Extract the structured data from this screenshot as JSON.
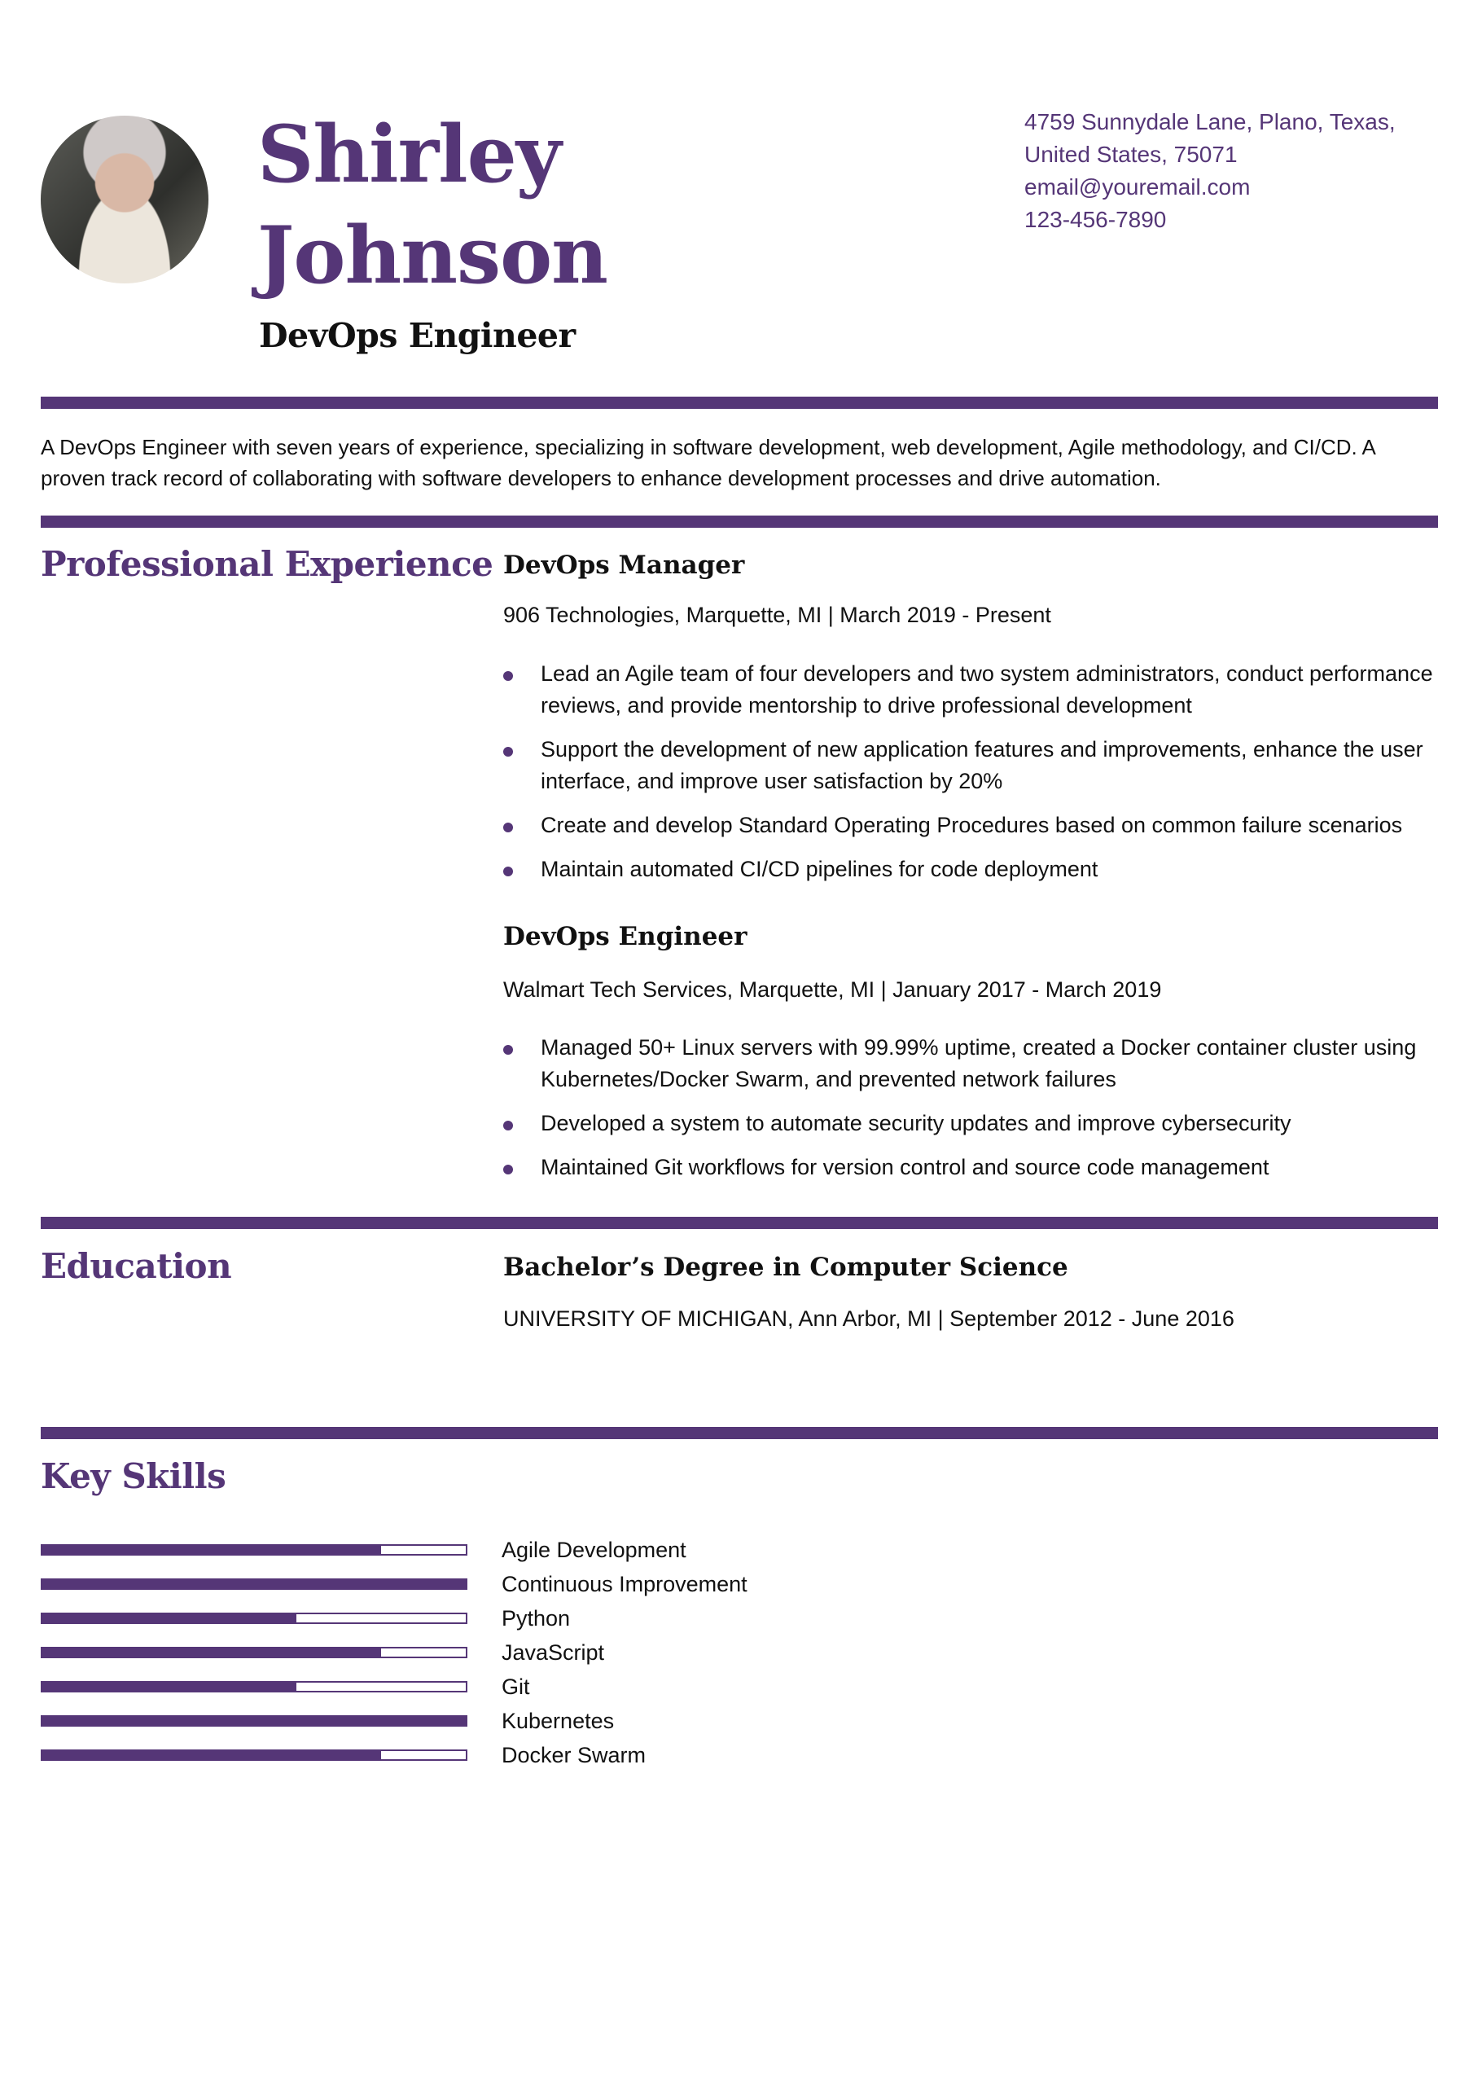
{
  "header": {
    "first_name": "Shirley",
    "last_name": "Johnson",
    "title": "DevOps Engineer",
    "photo_alt": "Profile photo"
  },
  "contact": {
    "address_line1": "4759 Sunnydale Lane, Plano, Texas,",
    "address_line2": "United States, 75071",
    "email": "email@youremail.com",
    "phone": "123-456-7890"
  },
  "summary": "A DevOps Engineer with seven years of experience, specializing in software development, web development, Agile methodology, and CI/CD. A proven track record of collaborating with software developers to enhance development processes and drive automation.",
  "experience": {
    "heading": "Professional Experience",
    "jobs": [
      {
        "title": "DevOps Manager",
        "meta": "906 Technologies, Marquette, MI | March 2019 - Present",
        "bullets": [
          "Lead an Agile team of four developers and two system administrators, conduct performance reviews, and provide mentorship to drive professional development",
          "Support the development of new application features and improvements, enhance the user interface, and improve user satisfaction by 20%",
          "Create and develop Standard Operating Procedures based on common failure scenarios",
          "Maintain automated CI/CD pipelines for code deployment"
        ]
      },
      {
        "title": "DevOps Engineer",
        "meta": "Walmart Tech Services, Marquette, MI | January 2017 - March 2019",
        "bullets": [
          "Managed 50+ Linux servers with 99.99% uptime, created a Docker container cluster using Kubernetes/Docker Swarm, and prevented network failures",
          "Developed a system to automate security updates and improve cybersecurity",
          "Maintained Git workflows for version control and source code management"
        ]
      }
    ]
  },
  "education": {
    "heading": "Education",
    "degree": "Bachelor’s Degree in Computer Science",
    "meta": "UNIVERSITY OF MICHIGAN, Ann Arbor, MI | September 2012 - June 2016"
  },
  "skills": {
    "heading": "Key Skills",
    "scale_max": 5,
    "items": [
      {
        "label": "Agile Development",
        "level": 4
      },
      {
        "label": "Continuous Improvement",
        "level": 5
      },
      {
        "label": "Python",
        "level": 3
      },
      {
        "label": "JavaScript",
        "level": 4
      },
      {
        "label": "Git",
        "level": 3
      },
      {
        "label": "Kubernetes",
        "level": 5
      },
      {
        "label": "Docker Swarm",
        "level": 4
      }
    ]
  },
  "colors": {
    "accent": "#553677",
    "text": "#111111"
  }
}
